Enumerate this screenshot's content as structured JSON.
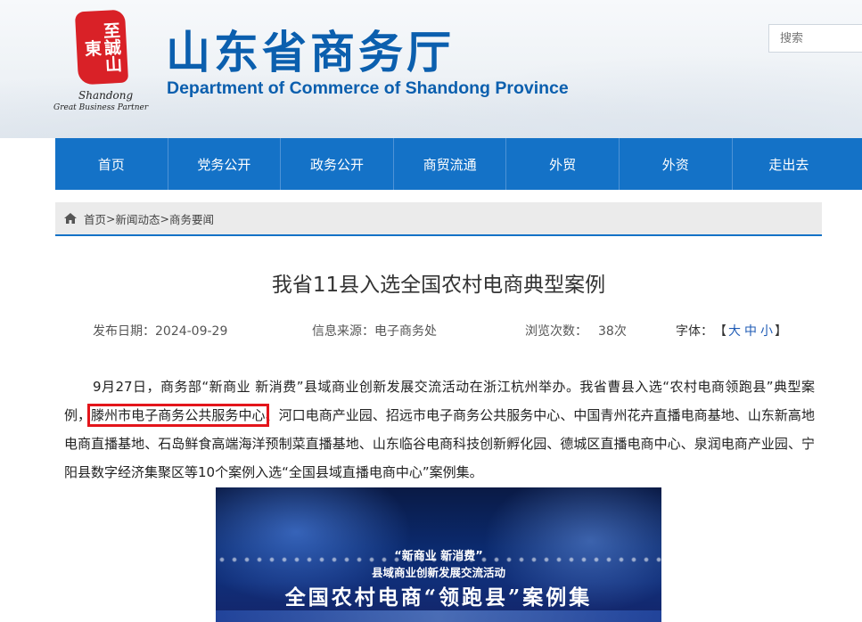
{
  "header": {
    "logo_seal_text": "至誠山東",
    "logo_line1": "Shandong",
    "logo_line2": "Great Business Partner",
    "title": "山东省商务厅",
    "subtitle": "Department of Commerce of Shandong Province",
    "search_placeholder": "搜索"
  },
  "nav": {
    "items": [
      "首页",
      "党务公开",
      "政务公开",
      "商贸流通",
      "外贸",
      "外资",
      "走出去"
    ]
  },
  "breadcrumb": {
    "home": "首页",
    "sep": ">",
    "level2": "新闻动态",
    "level3": "商务要闻"
  },
  "article": {
    "title": "我省11县入选全国农村电商典型案例",
    "date_label": "发布日期：",
    "date": "2024-09-29",
    "source_label": "信息来源：",
    "source": "电子商务处",
    "views_label": "浏览次数：",
    "views": "38次",
    "font_label": "字体：",
    "font_open": "【",
    "font_large": "大",
    "font_medium": "中",
    "font_small": "小",
    "font_close": "】",
    "body_before": "9月27日，商务部“新商业 新消费”县域商业创新发展交流活动在浙江杭州举办。我省曹县入选“农村电商领跑县”典型案例，",
    "body_highlight": "滕州市电子商务公共服务中心",
    "body_after": "、河口电商产业园、招远市电子商务公共服务中心、中国青州花卉直播电商基地、山东新高地电商直播基地、石岛鲜食高端海洋预制菜直播基地、山东临谷电商科技创新孵化园、德城区直播电商中心、泉润电商产业园、宁阳县数字经济集聚区等10个案例入选“全国县域直播电商中心”案例集。"
  },
  "image": {
    "line1": "“新商业 新消费”",
    "line2": "县域商业创新发展交流活动",
    "line3": "全国农村电商“领跑县”案例集"
  },
  "colors": {
    "brand_blue": "#0b5fae",
    "nav_blue": "#1472c7",
    "highlight_red": "#e3151b",
    "seal_red": "#d92127"
  }
}
